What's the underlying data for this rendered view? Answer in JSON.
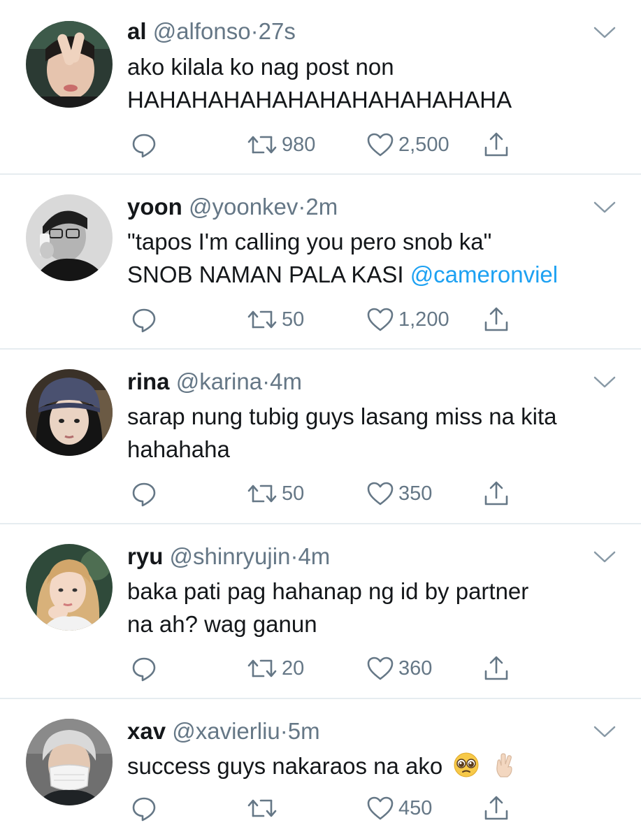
{
  "tweets": [
    {
      "name": "al",
      "handle": "@alfonso",
      "separator": "·",
      "time": "27s",
      "lines": [
        "ako kilala ko nag post non",
        "HAHAHAHAHAHAHAHAHAHAHAHA"
      ],
      "retweets": "980",
      "likes": "2,500"
    },
    {
      "name": "yoon",
      "handle": "@yoonkev",
      "separator": "·",
      "time": "2m",
      "lines": [
        "\"tapos I'm calling you pero snob ka\"",
        "SNOB NAMAN PALA KASI "
      ],
      "mention": "@cameronviel",
      "retweets": "50",
      "likes": "1,200"
    },
    {
      "name": "rina",
      "handle": "@karina",
      "separator": "·",
      "time": "4m",
      "lines": [
        "sarap nung tubig guys lasang miss na kita",
        "hahahaha"
      ],
      "retweets": "50",
      "likes": "350"
    },
    {
      "name": "ryu",
      "handle": "@shinryujin",
      "separator": "·",
      "time": "4m",
      "lines": [
        "baka pati pag hahanap ng id by partner",
        "na ah? wag ganun"
      ],
      "retweets": "20",
      "likes": "360"
    },
    {
      "name": "xav",
      "handle": "@xavierliu",
      "separator": "·",
      "time": "5m",
      "lines": [
        "success guys nakaraos na ako"
      ],
      "emojis": [
        "pleading-face",
        "crossed-fingers-light-skin"
      ],
      "retweets": "",
      "likes": "450"
    }
  ],
  "colors": {
    "text": "#14171a",
    "secondary": "#657786",
    "link": "#1da1f2",
    "divider": "#e6ecf0"
  },
  "icons": {
    "reply": "reply-icon",
    "retweet": "retweet-icon",
    "like": "heart-icon",
    "share": "share-icon",
    "menu": "chevron-down-icon"
  }
}
